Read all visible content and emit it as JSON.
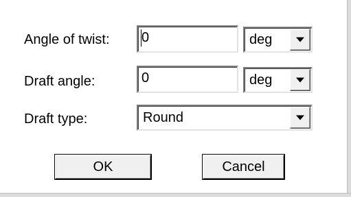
{
  "dialog": {
    "angle_of_twist": {
      "label": "Angle of twist:",
      "value": "0",
      "unit": "deg"
    },
    "draft_angle": {
      "label": "Draft angle:",
      "value": "0",
      "unit": "deg"
    },
    "draft_type": {
      "label": "Draft type:",
      "value": "Round"
    },
    "ok_label": "OK",
    "cancel_label": "Cancel"
  },
  "icons": {
    "dropdown": "chevron-down-icon"
  },
  "colors": {
    "background": "#ffffff",
    "button_face": "#f0f0f0",
    "frame": "#dcdcdc",
    "text": "#000000"
  }
}
